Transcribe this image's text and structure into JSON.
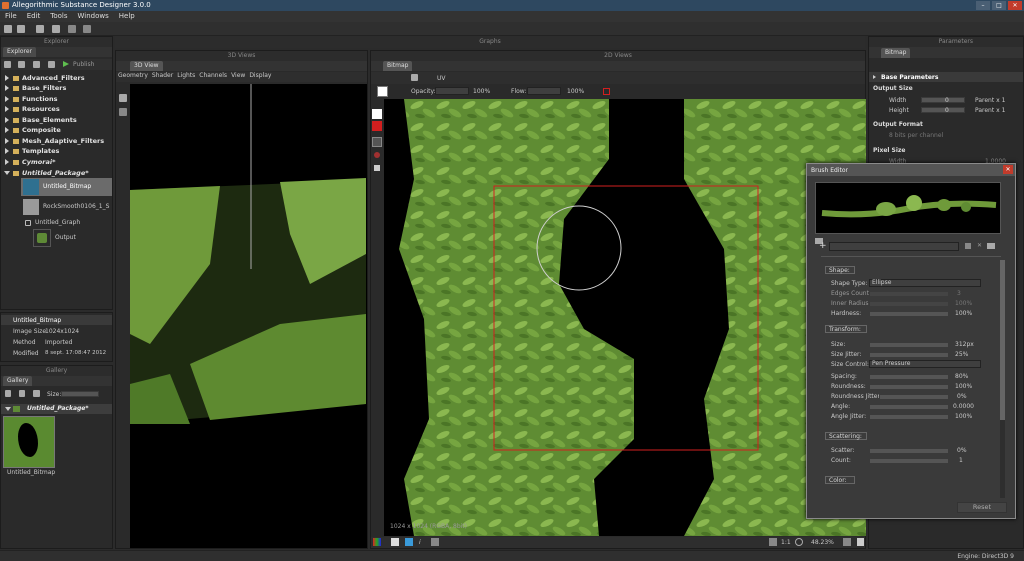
{
  "window": {
    "title": "Allegorithmic Substance Designer 3.0.0"
  },
  "menu": [
    "File",
    "Edit",
    "Tools",
    "Windows",
    "Help"
  ],
  "explorer": {
    "title": "Explorer",
    "publish_label": "Publish",
    "items": [
      "Advanced_Filters",
      "Base_Filters",
      "Functions",
      "Resources",
      "Base_Elements",
      "Composite",
      "Mesh_Adaptive_Filters",
      "Templates",
      "Cymorai*",
      "Untitled_Package*"
    ],
    "children": [
      "Untitled_Bitmap",
      "RockSmooth0106_1_S",
      "Untitled_Graph",
      "Output"
    ]
  },
  "properties": {
    "name": "Untitled_Bitmap",
    "rows": [
      {
        "key": "Image Size",
        "value": "1024x1024"
      },
      {
        "key": "Method",
        "value": "Imported"
      },
      {
        "key": "Modified",
        "value": "8 sept. 17:08:47 2012"
      }
    ]
  },
  "gallery": {
    "title": "Gallery",
    "size_label": "Size:",
    "package": "Untitled_Package*",
    "thumb_label": "Untitled_Bitmap"
  },
  "view3d": {
    "title": "3D Views",
    "tab": "3D View",
    "menu": [
      "Geometry",
      "Shader",
      "Lights",
      "Channels",
      "View",
      "Display"
    ]
  },
  "graphs_title": "Graphs",
  "view2d": {
    "title": "2D Views",
    "tab": "Bitmap",
    "uv_label": "UV",
    "opacity_label": "Opacity:",
    "opacity_value": "100%",
    "flow_label": "Flow:",
    "flow_value": "100%",
    "image_info": "1024 x 1024 (RGBA, 8bit)",
    "ratio": "1:1",
    "zoom": "48.23%"
  },
  "parameters": {
    "title": "Parameters",
    "tab": "Bitmap",
    "section": "Base Parameters",
    "output_size": "Output Size",
    "width_label": "Width",
    "width_value": "0",
    "width_parent": "Parent x 1",
    "height_label": "Height",
    "height_value": "0",
    "height_parent": "Parent x 1",
    "output_format": "Output Format",
    "output_format_value": "8 bits per channel",
    "pixel_size": "Pixel Size",
    "pixel_width_label": "Width",
    "pixel_width_value": "1.0000"
  },
  "brush_editor": {
    "title": "Brush Editor",
    "shape_header": "Shape:",
    "shape_type_label": "Shape Type:",
    "shape_type_value": "Ellipse",
    "edges_count_label": "Edges Count:",
    "edges_count_value": "3",
    "inner_radius_label": "Inner Radius:",
    "inner_radius_value": "100%",
    "hardness_label": "Hardness:",
    "hardness_value": "100%",
    "transform_header": "Transform:",
    "size_label": "Size:",
    "size_value": "312px",
    "size_jitter_label": "Size Jitter:",
    "size_jitter_value": "25%",
    "size_control_label": "Size Control:",
    "size_control_value": "Pen Pressure",
    "spacing_label": "Spacing:",
    "spacing_value": "80%",
    "roundness_label": "Roundness:",
    "roundness_value": "100%",
    "roundness_jitter_label": "Roundness Jitter:",
    "roundness_jitter_value": "0%",
    "angle_label": "Angle:",
    "angle_value": "0.0000",
    "angle_jitter_label": "Angle Jitter:",
    "angle_jitter_value": "100%",
    "scattering_header": "Scattering:",
    "scatter_label": "Scatter:",
    "scatter_value": "0%",
    "count_label": "Count:",
    "count_value": "1",
    "color_header": "Color:",
    "reset_label": "Reset"
  },
  "status": {
    "engine": "Engine: Direct3D 9"
  },
  "colors": {
    "accent_red": "#d21f1f",
    "foliage": "#6f9a3a",
    "title_bar": "#2e4860"
  }
}
